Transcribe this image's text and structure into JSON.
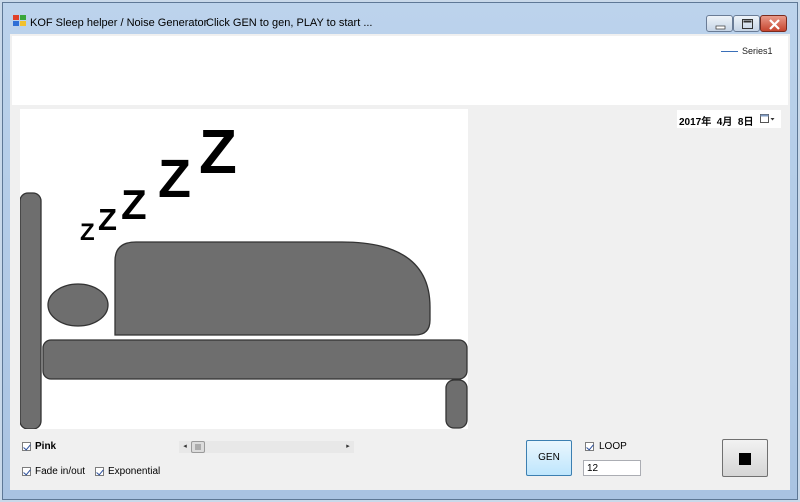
{
  "window": {
    "title": "KOF Sleep helper / Noise Generator",
    "status_hint": "Click GEN to gen, PLAY to start ..."
  },
  "titlebar_buttons": {
    "minimize_icon": "minimize-icon",
    "maximize_icon": "maximize-icon",
    "close_icon": "close-icon"
  },
  "chart": {
    "type": "line",
    "legend_placement": "top-right",
    "series": [
      {
        "name": "Series1",
        "values": []
      }
    ],
    "series_color": "#3a6fb8"
  },
  "chart_data": {
    "type": "line",
    "series": [
      {
        "name": "Series1",
        "values": []
      }
    ]
  },
  "picture": {
    "zzz_letters": [
      "Z",
      "Z",
      "Z",
      "Z",
      "Z"
    ],
    "fill_color": "#6e6e6e"
  },
  "date": {
    "value": "2017年  4月  8日"
  },
  "controls": {
    "pink_label": "Pink",
    "pink_checked": true,
    "fade_label": "Fade in/out",
    "fade_checked": true,
    "exponential_label": "Exponential",
    "exponential_checked": true,
    "scroll_left": "◂",
    "scroll_right": "▸",
    "gen_label": "GEN",
    "loop_label": "LOOP",
    "loop_checked": true,
    "loop_value": "12",
    "stop_icon": "stop-icon"
  }
}
